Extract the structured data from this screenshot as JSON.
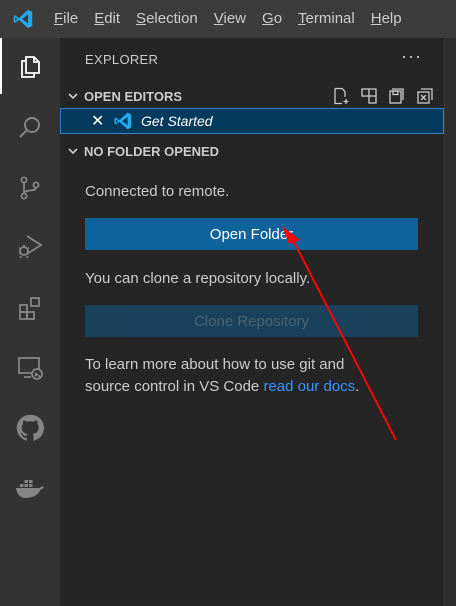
{
  "menubar": {
    "items": [
      {
        "mnemonic": "F",
        "rest": "ile"
      },
      {
        "mnemonic": "E",
        "rest": "dit"
      },
      {
        "mnemonic": "S",
        "rest": "election"
      },
      {
        "mnemonic": "V",
        "rest": "iew"
      },
      {
        "mnemonic": "G",
        "rest": "o"
      },
      {
        "mnemonic": "T",
        "rest": "erminal"
      },
      {
        "mnemonic": "H",
        "rest": "elp"
      }
    ]
  },
  "activitybar": {
    "icons": [
      "explorer-icon",
      "search-icon",
      "source-control-icon",
      "run-debug-icon",
      "extensions-icon",
      "remote-explorer-icon",
      "github-icon",
      "docker-icon"
    ]
  },
  "sidebar": {
    "title": "EXPLORER",
    "more": "···",
    "open_editors": {
      "header": "OPEN EDITORS",
      "items": [
        {
          "close": "✕",
          "label": "Get Started"
        }
      ]
    },
    "no_folder": {
      "header": "NO FOLDER OPENED",
      "connected_text": "Connected to remote.",
      "open_folder_button": "Open Folder",
      "clone_text": "You can clone a repository locally.",
      "clone_button": "Clone Repository",
      "learn_text_before": "To learn more about how to use git and source control in VS Code ",
      "learn_link": "read our docs",
      "learn_text_after": "."
    }
  },
  "colors": {
    "accent": "#0e639c",
    "link": "#3794ff",
    "annotation_arrow": "#ff0000"
  }
}
